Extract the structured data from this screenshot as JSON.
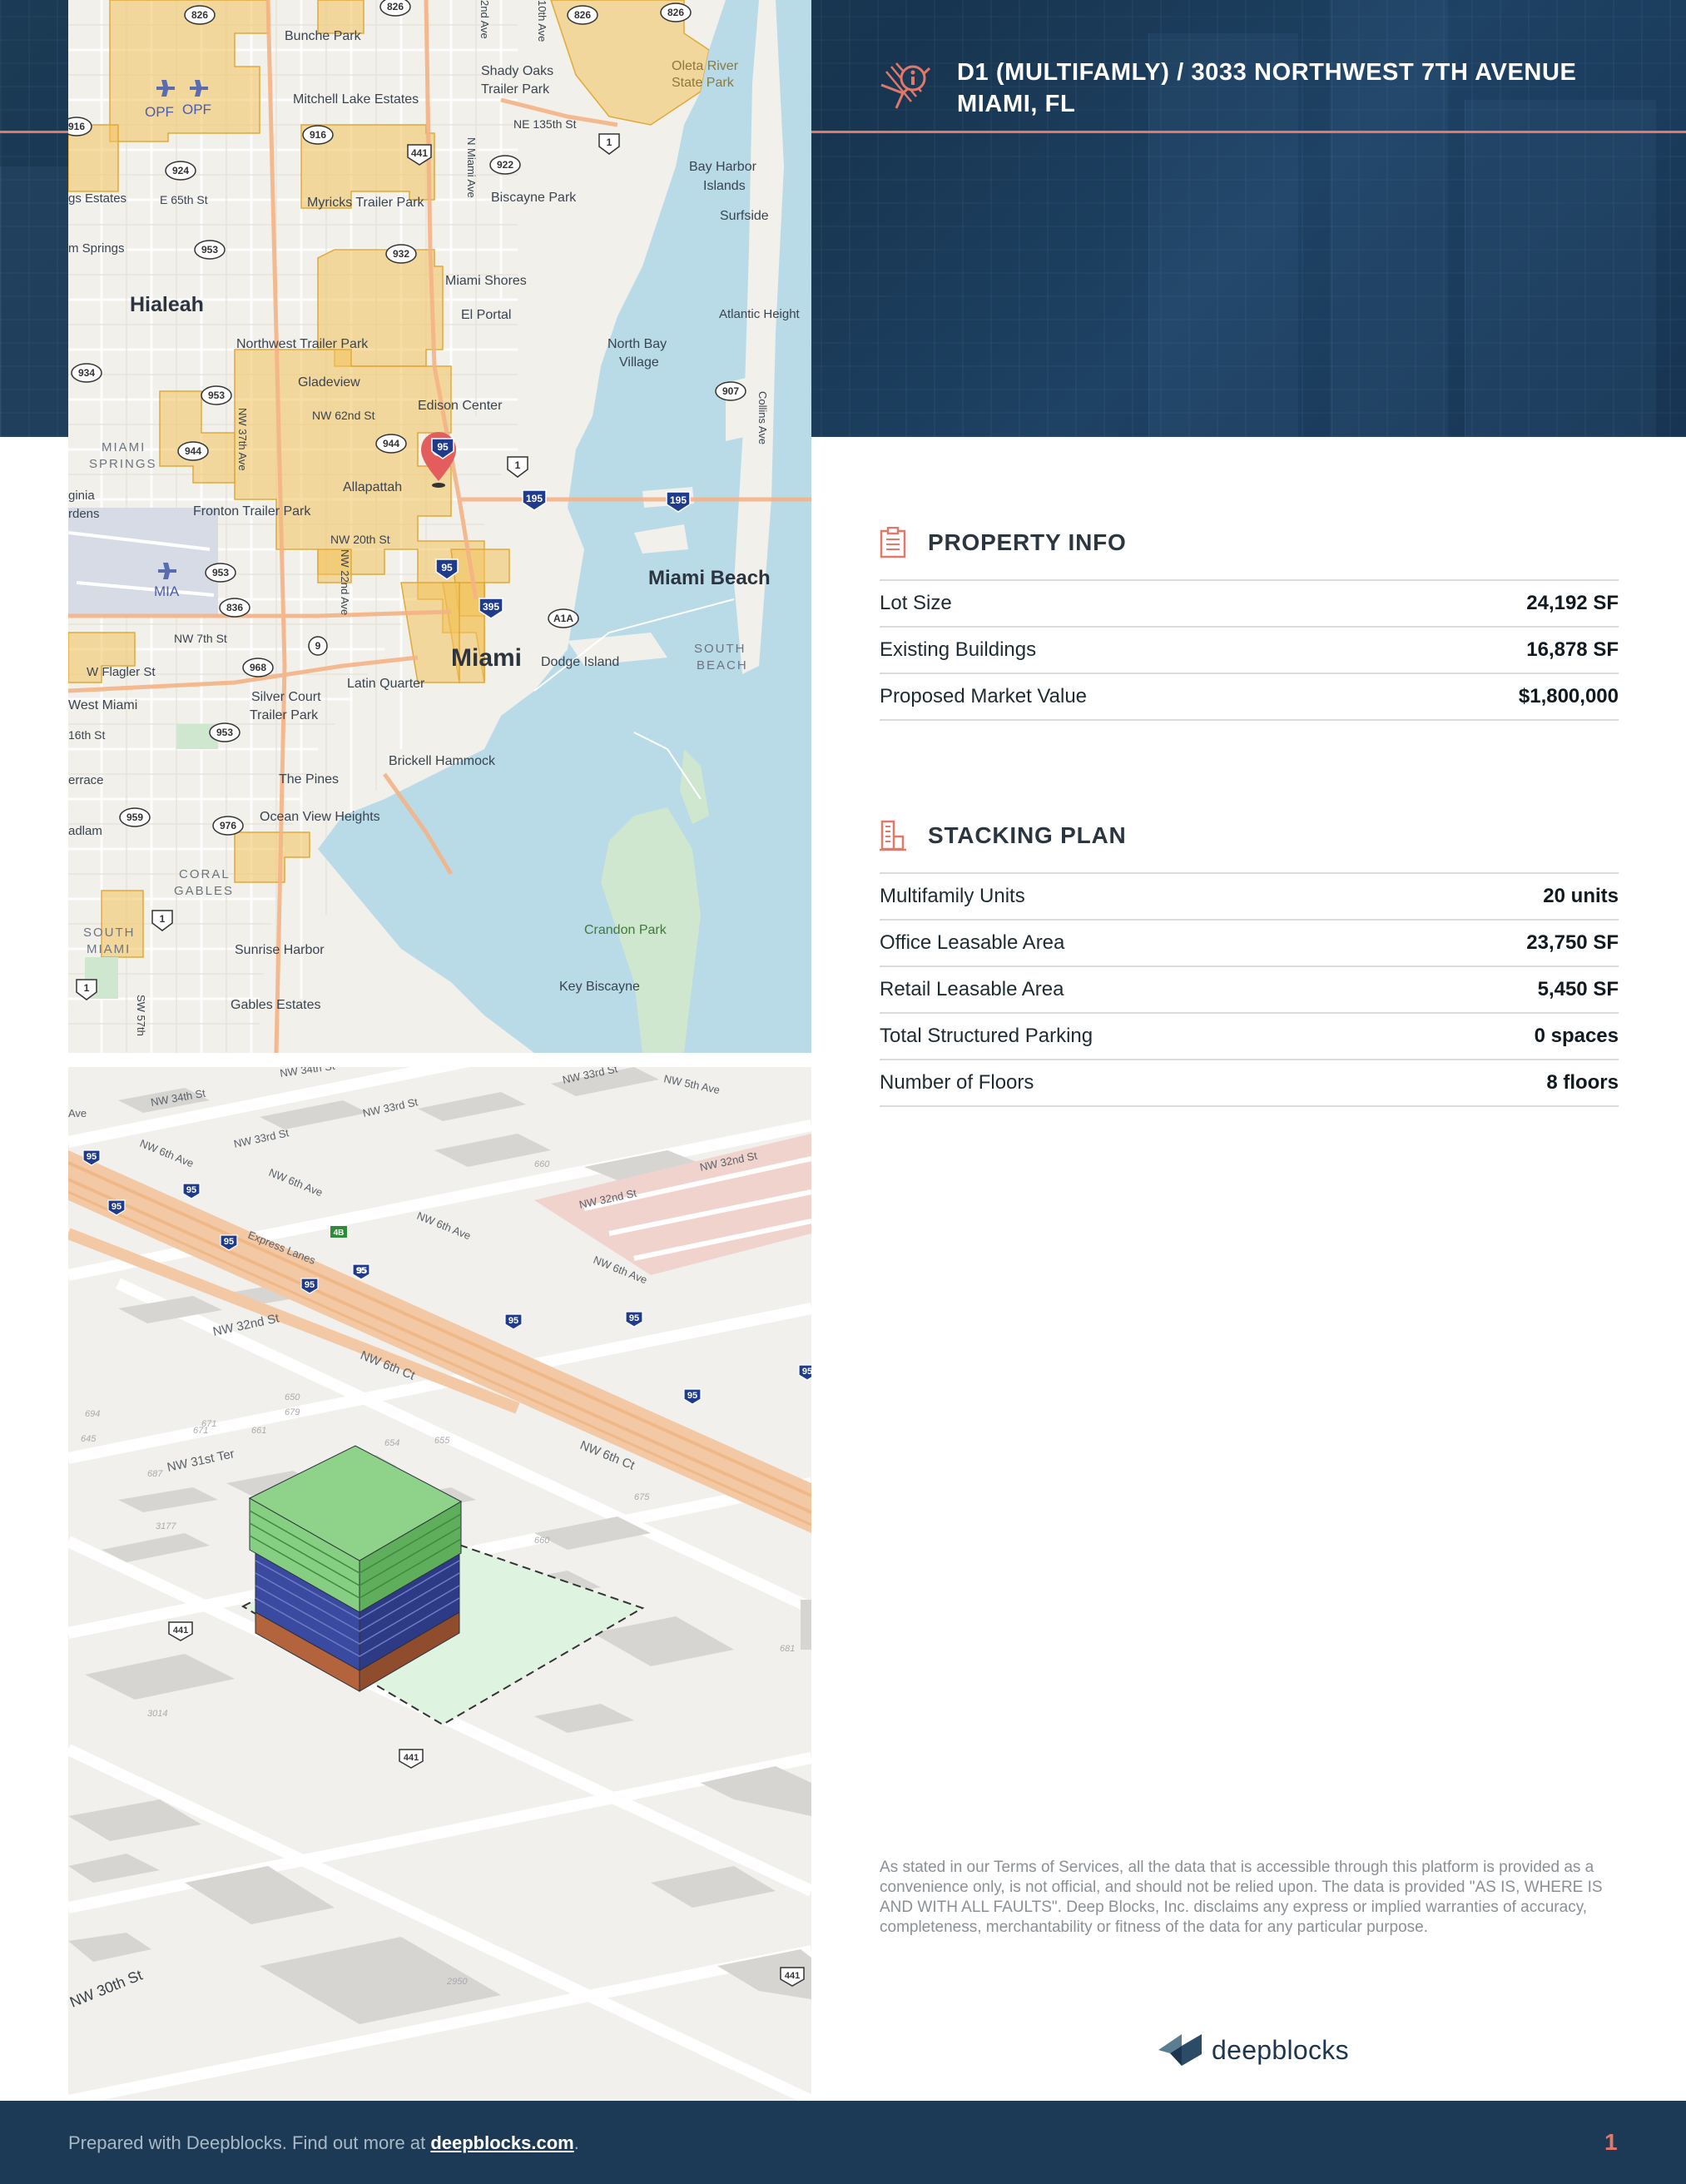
{
  "header": {
    "title_line1": "D1 (MULTIFAMLY) / 3033 NORTHWEST 7TH AVENUE",
    "title_line2": "MIAMI, FL",
    "icon": "location-info-icon"
  },
  "map": {
    "labels": {
      "bunche_park": "Bunche Park",
      "shady_oaks": "Shady Oaks",
      "trailer_park": "Trailer Park",
      "oleta_river": "Oleta River",
      "state_park": "State Park",
      "opf": "OPF",
      "mitchell_lake": "Mitchell Lake Estates",
      "ne_135th": "NE 135th St",
      "bay_harbor": "Bay Harbor",
      "islands": "Islands",
      "surfside": "Surfside",
      "gs_estates": "gs Estates",
      "e_65th": "E 65th St",
      "myricks": "Myricks Trailer Park",
      "biscayne_park": "Biscayne Park",
      "m_springs": "m Springs",
      "hialeah": "Hialeah",
      "miami_shores": "Miami Shores",
      "el_portal": "El Portal",
      "atlantic_heights": "Atlantic Height",
      "northwest_trailer": "Northwest Trailer Park",
      "north_bay": "North Bay",
      "village": "Village",
      "gladeview": "Gladeview",
      "nw_62nd": "NW 62nd St",
      "edison_center": "Edison Center",
      "miami_springs_1": "MIAMI",
      "miami_springs_2": "SPRINGS",
      "allapattah": "Allapattah",
      "ginia": "ginia",
      "rdens": "rdens",
      "fronton": "Fronton Trailer Park",
      "nw_20th": "NW 20th St",
      "miami_beach": "Miami Beach",
      "mia": "MIA",
      "nw_7th": "NW 7th St",
      "miami": "Miami",
      "dodge_island": "Dodge Island",
      "south_beach_1": "SOUTH",
      "south_beach_2": "BEACH",
      "w_flagler": "W Flagler St",
      "latin_quarter": "Latin Quarter",
      "west_miami": "West Miami",
      "silver_court_1": "Silver Court",
      "silver_court_2": "Trailer Park",
      "16th": "16th St",
      "the_pines": "The Pines",
      "brickell": "Brickell Hammock",
      "terrace": "errace",
      "ocean_view": "Ocean View Heights",
      "adlam": "adlam",
      "coral_gables_1": "CORAL",
      "coral_gables_2": "GABLES",
      "south_miami_1": "SOUTH",
      "south_miami_2": "MIAMI",
      "sunrise_harbor": "Sunrise Harbor",
      "crandon_park": "Crandon Park",
      "key_biscayne": "Key Biscayne",
      "gables_estates": "Gables Estates",
      "nw_37th": "NW 37th Ave",
      "nw_22nd": "NW 22nd Ave",
      "n_miami_ave": "N Miami Ave",
      "collins": "Collins Ave",
      "sw_57th": "SW 57th",
      "2nd_ave": "2nd Ave",
      "10th_ave": "10th Ave"
    },
    "shields": [
      "826",
      "826",
      "826",
      "826",
      "916",
      "924",
      "916",
      "922",
      "441",
      "1",
      "953",
      "932",
      "934",
      "953",
      "944",
      "944",
      "95",
      "1",
      "195",
      "195",
      "953",
      "907",
      "836",
      "95",
      "395",
      "A1A",
      "9",
      "968",
      "953",
      "959",
      "976",
      "1",
      "1"
    ]
  },
  "iso_map": {
    "streets": {
      "nw_34th_1": "NW 34th St",
      "nw_34th_2": "NW 34th St",
      "nw_33rd_1": "NW 33rd St",
      "nw_33rd_2": "NW 33rd St",
      "nw_33rd_3": "NW 33rd St",
      "nw_5th": "NW 5th Ave",
      "nw_6th_1": "NW 6th Ave",
      "nw_6th_2": "NW 6th Ave",
      "nw_6th_3": "NW 6th Ave",
      "nw_6th_4": "NW 6th Ave",
      "nw_32nd_1": "NW 32nd St",
      "nw_32nd_2": "NW 32nd St",
      "nw_32nd_3": "NW 32nd St",
      "express": "Express Lanes",
      "nw_6th_ct_1": "NW 6th Ct",
      "nw_6th_ct_2": "NW 6th Ct",
      "nw_31st": "NW 31st Ter",
      "nw_30th": "NW 30th St",
      "ave": "Ave"
    },
    "shields": [
      "95",
      "95",
      "95",
      "95",
      "95",
      "95",
      "95",
      "95",
      "95",
      "95",
      "95",
      "441",
      "441",
      "441"
    ],
    "exit": "4B",
    "parcel_numbers": [
      "3177",
      "3014",
      "2950",
      "660",
      "681",
      "648",
      "661",
      "671",
      "645",
      "655",
      "654",
      "687",
      "650",
      "660",
      "679",
      "694",
      "671",
      "668",
      "675"
    ]
  },
  "property_info": {
    "title": "PROPERTY INFO",
    "icon": "clipboard-icon",
    "rows": [
      {
        "label": "Lot Size",
        "value": "24,192 SF"
      },
      {
        "label": "Existing Buildings",
        "value": "16,878 SF"
      },
      {
        "label": "Proposed Market Value",
        "value": "$1,800,000"
      }
    ]
  },
  "stacking_plan": {
    "title": "STACKING PLAN",
    "icon": "building-icon",
    "rows": [
      {
        "label": "Multifamily Units",
        "value": "20 units"
      },
      {
        "label": "Office Leasable Area",
        "value": "23,750 SF"
      },
      {
        "label": "Retail Leasable Area",
        "value": "5,450 SF"
      },
      {
        "label": "Total Structured Parking",
        "value": "0 spaces"
      },
      {
        "label": "Number of Floors",
        "value": "8 floors"
      }
    ]
  },
  "disclaimer": "As stated in our Terms of Services, all the data that is accessible through this platform is provided as a convenience only, is not official, and should not be relied upon. The data is provided \"AS IS, WHERE IS AND WITH ALL FAULTS\". Deep Blocks, Inc. disclaims any express or implied warranties of accuracy, completeness, merchantability or fitness of the data for any particular purpose.",
  "brand": {
    "name": "deepblocks",
    "icon": "deepblocks-logo-icon"
  },
  "footer": {
    "prefix": "Prepared with Deepblocks. Find out more at ",
    "link": "deepblocks.com",
    "suffix": ".",
    "page": "1"
  },
  "colors": {
    "navy": "#1c3a55",
    "accent": "#e2786a",
    "zone": "#f2c25b",
    "water": "#b9dbe8",
    "residential": "#86cf82",
    "office": "#3a4aa0",
    "retail": "#b4643c",
    "parcel": "#dff3e1"
  }
}
